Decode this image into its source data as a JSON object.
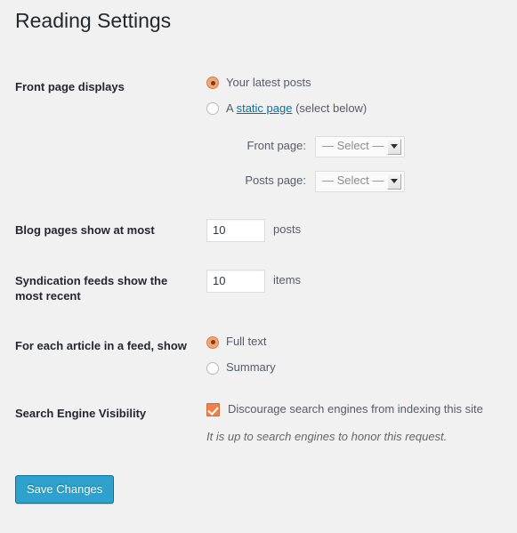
{
  "page": {
    "title": "Reading Settings",
    "background_color": "#f1f1f1",
    "accent_color": "#2ea2cc",
    "radio_accent_color": "#f0a678",
    "checkbox_accent_color": "#f0814a",
    "link_color": "#0073aa"
  },
  "rows": {
    "front_page_displays": {
      "label": "Front page displays",
      "options": [
        {
          "label": "Your latest posts",
          "checked": true
        },
        {
          "label_before_link": "A ",
          "link_text": "static page",
          "label_after_link": " (select below)",
          "checked": false
        }
      ],
      "selects": [
        {
          "label": "Front page:",
          "value": "— Select —"
        },
        {
          "label": "Posts page:",
          "value": "— Select —"
        }
      ]
    },
    "blog_pages": {
      "label": "Blog pages show at most",
      "value": "10",
      "unit": "posts"
    },
    "syndication_feeds": {
      "label": "Syndication feeds show the most recent",
      "value": "10",
      "unit": "items"
    },
    "feed_article": {
      "label": "For each article in a feed, show",
      "options": [
        {
          "label": "Full text",
          "checked": true
        },
        {
          "label": "Summary",
          "checked": false
        }
      ]
    },
    "search_engine_visibility": {
      "label": "Search Engine Visibility",
      "checkbox_label": "Discourage search engines from indexing this site",
      "checked": true,
      "description": "It is up to search engines to honor this request."
    }
  },
  "submit": {
    "save_label": "Save Changes"
  }
}
